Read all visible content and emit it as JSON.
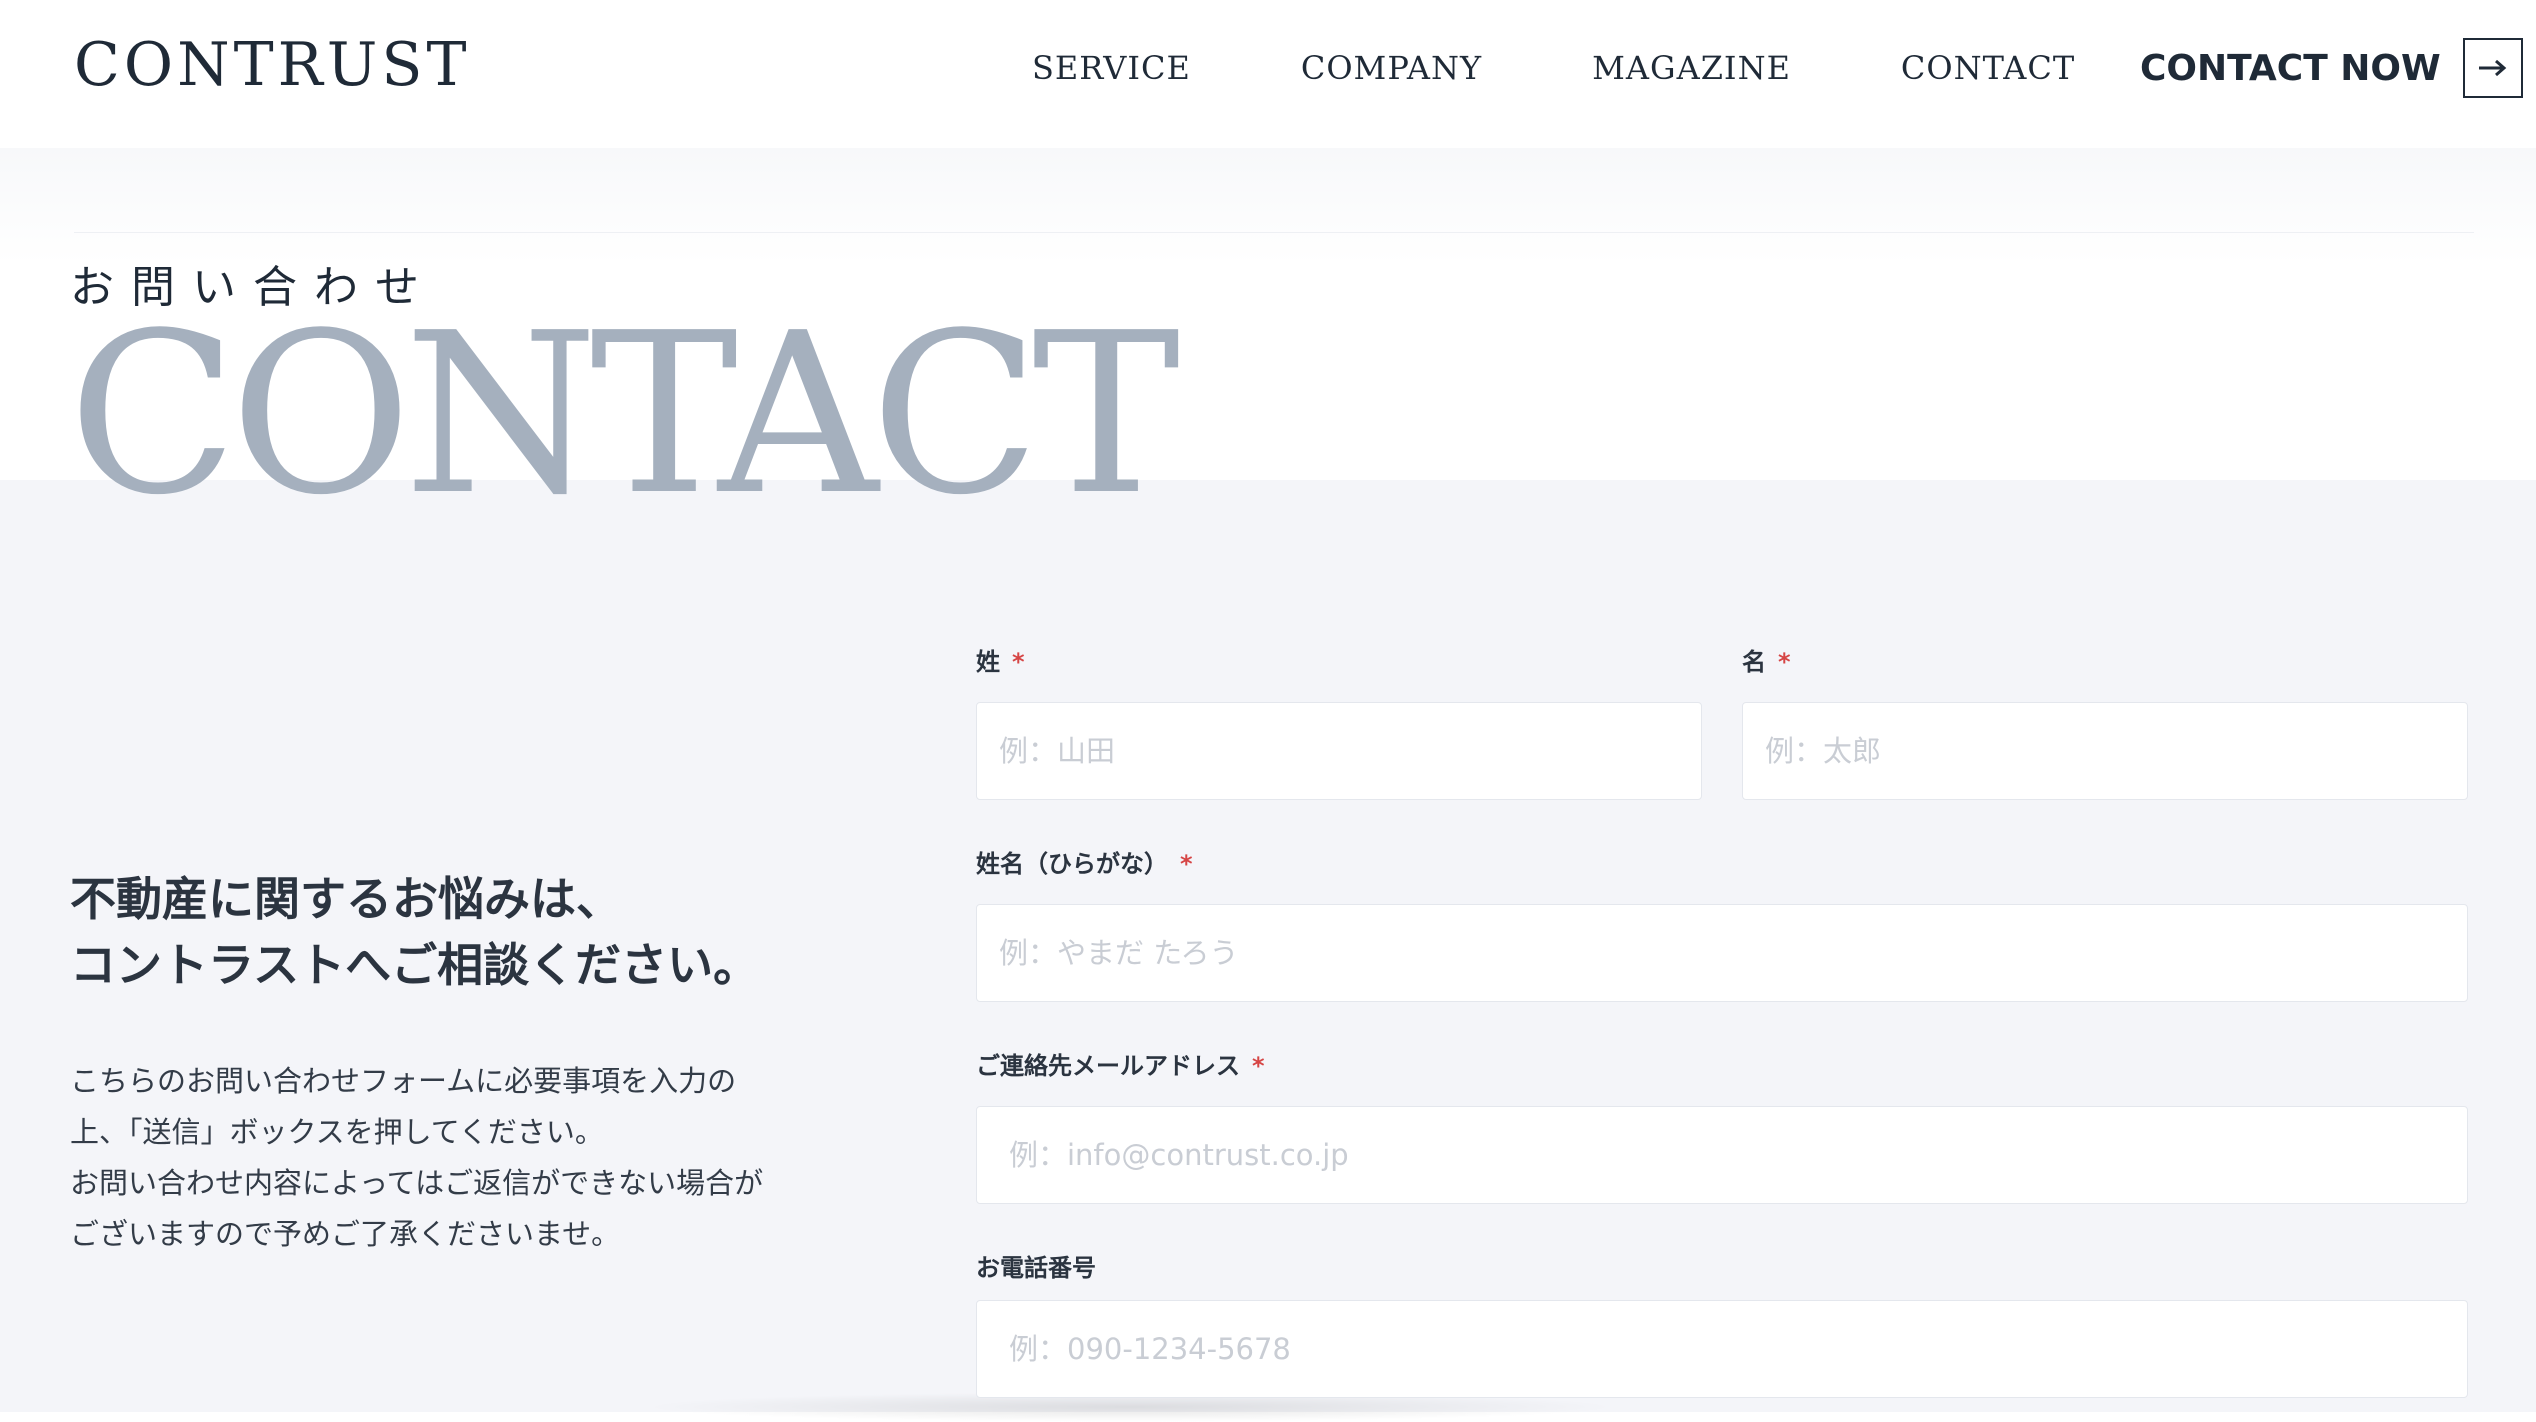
{
  "header": {
    "logo": "CONTRUST",
    "nav": [
      {
        "label": "SERVICE"
      },
      {
        "label": "COMPANY"
      },
      {
        "label": "MAGAZINE"
      },
      {
        "label": "CONTACT"
      }
    ],
    "cta": {
      "label": "CONTACT NOW",
      "icon": "arrow-right-icon"
    }
  },
  "hero": {
    "subtitle": "お問い合わせ",
    "title": "CONTACT"
  },
  "lead": {
    "heading_line1": "不動産に関するお悩みは、",
    "heading_line2": "コントラストへご相談ください。",
    "body_lines": [
      "こちらのお問い合わせフォームに必要事項を入力の",
      "上、「送信」ボックスを押してください。",
      "お問い合わせ内容によってはご返信ができない場合が",
      "ございますので予めご了承くださいませ。"
    ]
  },
  "form": {
    "required_mark": "*",
    "last_name": {
      "label": "姓",
      "placeholder": "例：山田",
      "value": ""
    },
    "first_name": {
      "label": "名",
      "placeholder": "例：太郎",
      "value": ""
    },
    "kana": {
      "label": "姓名（ひらがな）",
      "placeholder": "例：やまだ たろう",
      "value": ""
    },
    "email": {
      "label": "ご連絡先メールアドレス",
      "placeholder": "例：info@contrust.co.jp",
      "value": ""
    },
    "phone": {
      "label": "お電話番号",
      "placeholder": "例：090-1234-5678",
      "value": ""
    }
  },
  "colors": {
    "text": "#1f2a37",
    "hero_title": "#a5b0be",
    "background_section": "#f4f5f9",
    "required": "#d64545",
    "placeholder": "#c9cdd4"
  }
}
